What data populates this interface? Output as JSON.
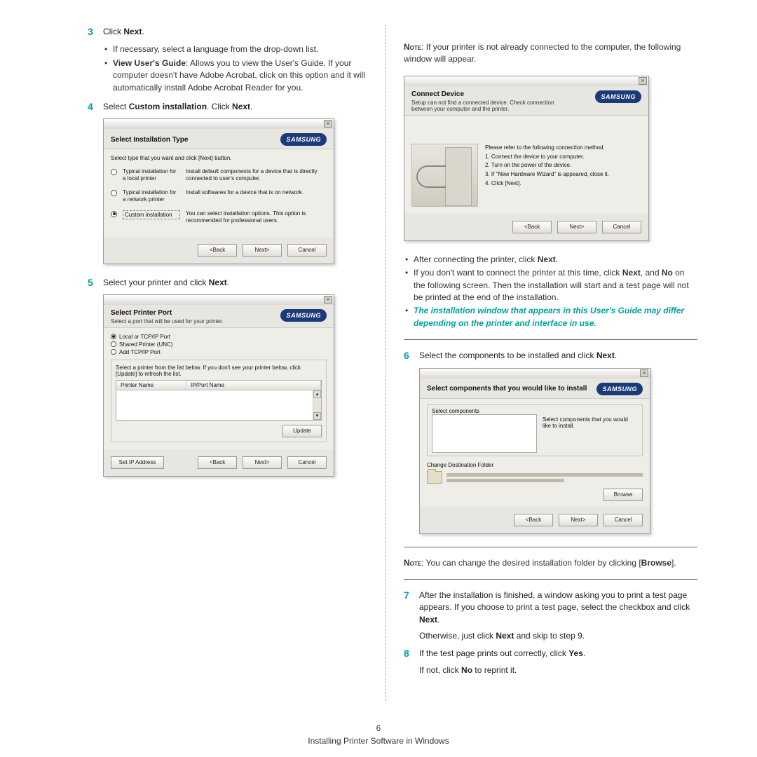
{
  "page_number": "6",
  "footer": "Installing Printer Software in Windows",
  "brand": "SAMSUNG",
  "left": {
    "step3": {
      "num": "3",
      "text_before": "Click ",
      "text_bold": "Next",
      "text_after": ".",
      "b1": "If necessary, select a language from the drop-down list.",
      "b2_bold": "View User's Guide",
      "b2_rest": ": Allows you to view the User's Guide. If your computer doesn't have Adobe Acrobat, click on this option and it will automatically install Adobe Acrobat Reader for you."
    },
    "step4": {
      "num": "4",
      "t1": "Select ",
      "t2": "Custom installation",
      "t3": ". Click ",
      "t4": "Next",
      "t5": "."
    },
    "dlg1": {
      "title": "Select Installation Type",
      "inst": "Select type that you want and click [Next] button.",
      "opt1_label": "Typical installation for a local printer",
      "opt1_desc": "Install default components for a device that is directly connected to user's computer.",
      "opt2_label": "Typical installation for a network printer",
      "opt2_desc": "Install softwares for a device that is on network.",
      "opt3_label": "Custom installation",
      "opt3_desc": "You can select installation options. This option is recommended for professional users.",
      "back": "<Back",
      "next": "Next>",
      "cancel": "Cancel"
    },
    "step5": {
      "num": "5",
      "t1": "Select your printer and click ",
      "t2": "Next",
      "t3": "."
    },
    "dlg2": {
      "title": "Select Printer Port",
      "sub": "Select a port that will be used for your printer.",
      "p1": "Local or TCP/IP Port",
      "p2": "Shared Printer (UNC)",
      "p3": "Add TCP/IP Port",
      "inst": "Select a printer from the list below. If you don't see your printer below, click [Update] to refresh the list.",
      "col1": "Printer Name",
      "col2": "IP/Port Name",
      "update": "Update",
      "setip": "Set IP Address",
      "back": "<Back",
      "next": "Next>",
      "cancel": "Cancel"
    }
  },
  "right": {
    "note1_caps": "Note",
    "note1_rest": ": If your printer is not already connected to the computer, the following window will appear.",
    "dlg3": {
      "title": "Connect Device",
      "sub": "Setup can not find a connected device. Check connection between your computer and the printer.",
      "lead": "Please refer to the following connection method.",
      "s1": "1. Connect the device to your computer.",
      "s2": "2. Turn on the power of the device.",
      "s3": "3. If \"New Hardware Wizard\" is appeared, close it.",
      "s4": "4. Click [Next].",
      "back": "<Back",
      "next": "Next>",
      "cancel": "Cancel"
    },
    "after": {
      "b1a": "After connecting the printer, click ",
      "b1b": "Next",
      "b1c": ".",
      "b2a": "If you don't want to connect the printer at this time, click ",
      "b2b": "Next",
      "b2c": ", and ",
      "b2d": "No",
      "b2e": " on the following screen. Then the installation will start and a test page will not be printed at the end of the installation.",
      "b3": "The installation window that appears in this User's Guide may differ depending on the printer and interface in use."
    },
    "step6": {
      "num": "6",
      "t1": "Select the components to be installed and click ",
      "t2": "Next",
      "t3": "."
    },
    "dlg4": {
      "title": "Select components that you would like to install",
      "groupLabel": "Select components",
      "sidetext": "Select components that you would like to install.",
      "folderLabel": "Change Destination Folder",
      "browse": "Browse",
      "back": "<Back",
      "next": "Next>",
      "cancel": "Cancel"
    },
    "note2_caps": "Note",
    "note2a": ": You can change the desired installation folder by clicking [",
    "note2b": "Browse",
    "note2c": "].",
    "step7": {
      "num": "7",
      "t1": "After the installation is finished, a window asking you to print a test page appears. If you choose to print a test page, select the checkbox and click ",
      "t2": "Next",
      "t3": ".",
      "t4a": "Otherwise, just click ",
      "t4b": "Next",
      "t4c": " and skip to step 9."
    },
    "step8": {
      "num": "8",
      "t1": "If the test page prints out correctly, click ",
      "t2": "Yes",
      "t3": ".",
      "t4a": "If not, click ",
      "t4b": "No",
      "t4c": " to reprint it."
    }
  }
}
